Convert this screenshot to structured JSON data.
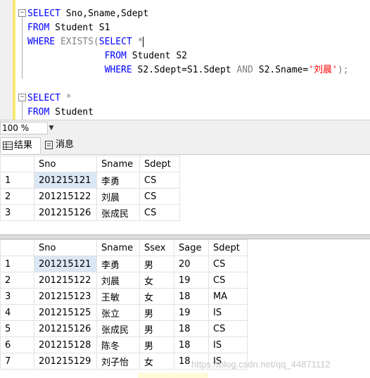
{
  "editor": {
    "lines": [
      {
        "segments": [
          {
            "t": "SELECT",
            "c": "kw"
          },
          {
            "t": " Sno,Sname,Sdept",
            "c": ""
          }
        ]
      },
      {
        "segments": [
          {
            "t": "FROM",
            "c": "kw"
          },
          {
            "t": " Student S1",
            "c": ""
          }
        ]
      },
      {
        "segments": [
          {
            "t": "WHERE",
            "c": "kw"
          },
          {
            "t": " EXISTS(",
            "c": "gr"
          },
          {
            "t": "SELECT",
            "c": "kw"
          },
          {
            "t": " *",
            "c": "gr"
          }
        ]
      },
      {
        "segments": [
          {
            "t": "              FROM",
            "c": "kw"
          },
          {
            "t": " Student S2",
            "c": ""
          }
        ]
      },
      {
        "segments": [
          {
            "t": "              WHERE",
            "c": "kw"
          },
          {
            "t": " S2.Sdept=S1.Sdept ",
            "c": ""
          },
          {
            "t": "AND",
            "c": "gr"
          },
          {
            "t": " S2.Sname=",
            "c": ""
          },
          {
            "t": "'刘晨'",
            "c": "str"
          },
          {
            "t": ");",
            "c": "gr"
          }
        ]
      },
      {
        "segments": []
      },
      {
        "segments": [
          {
            "t": "SELECT",
            "c": "kw"
          },
          {
            "t": " *",
            "c": "gr"
          }
        ]
      },
      {
        "segments": [
          {
            "t": "FROM",
            "c": "kw"
          },
          {
            "t": " Student",
            "c": ""
          }
        ]
      }
    ]
  },
  "zoom": {
    "value": "100 %"
  },
  "tabs": {
    "results": "结果",
    "messages": "消息"
  },
  "result1": {
    "columns": [
      "Sno",
      "Sname",
      "Sdept"
    ],
    "rows": [
      [
        "1",
        "201215121",
        "李勇",
        "CS"
      ],
      [
        "2",
        "201215122",
        "刘晨",
        "CS"
      ],
      [
        "3",
        "201215126",
        "张成民",
        "CS"
      ]
    ]
  },
  "result2": {
    "columns": [
      "Sno",
      "Sname",
      "Ssex",
      "Sage",
      "Sdept"
    ],
    "rows": [
      [
        "1",
        "201215121",
        "李勇",
        "男",
        "20",
        "CS"
      ],
      [
        "2",
        "201215122",
        "刘晨",
        "女",
        "19",
        "CS"
      ],
      [
        "3",
        "201215123",
        "王敏",
        "女",
        "18",
        "MA"
      ],
      [
        "4",
        "201215125",
        "张立",
        "男",
        "19",
        "IS"
      ],
      [
        "5",
        "201215126",
        "张成民",
        "男",
        "18",
        "CS"
      ],
      [
        "6",
        "201215128",
        "陈冬",
        "男",
        "18",
        "IS"
      ],
      [
        "7",
        "201215129",
        "刘子怡",
        "女",
        "18",
        "IS"
      ]
    ]
  },
  "watermark": "https://blog.csdn.net/qq_44871112"
}
